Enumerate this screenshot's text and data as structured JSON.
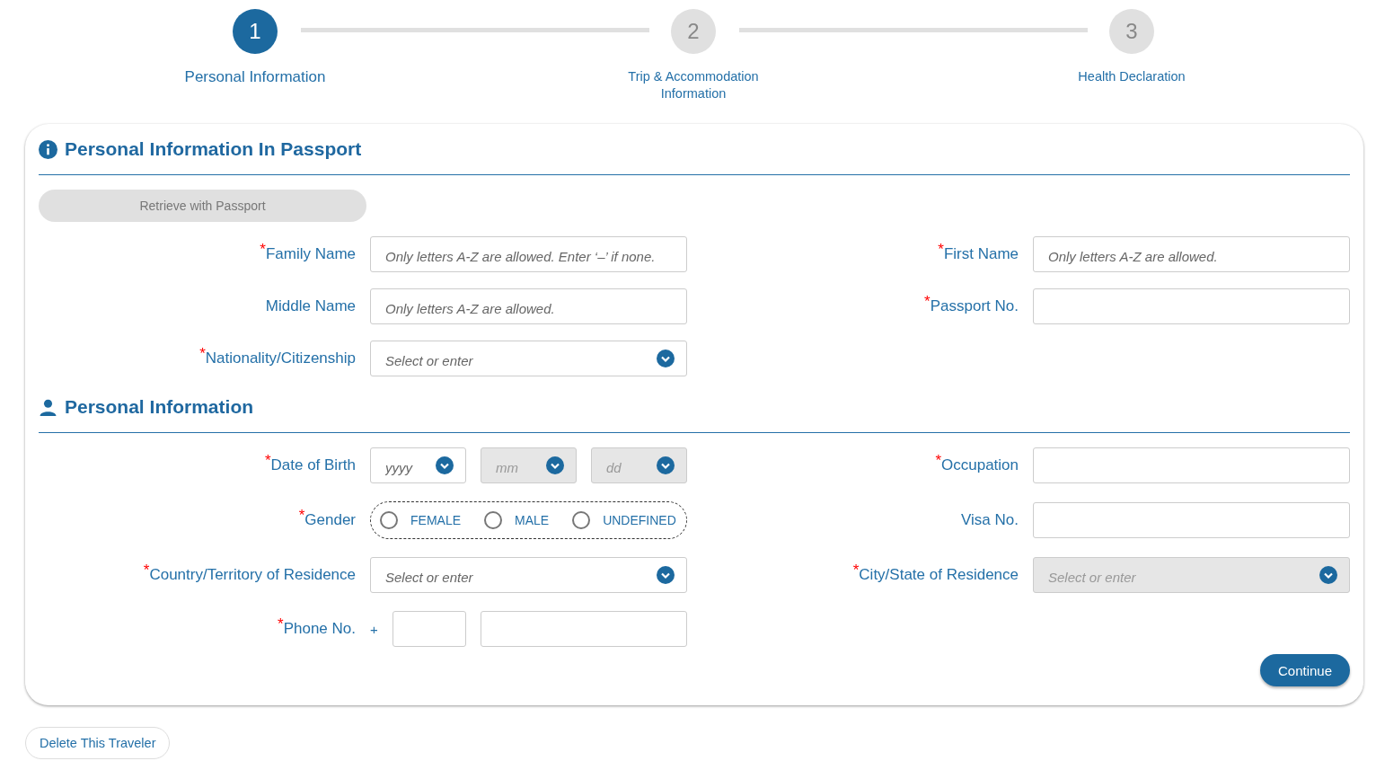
{
  "steps": [
    {
      "number": "1",
      "label": "Personal Information",
      "selected": true
    },
    {
      "number": "2",
      "label": "Trip & Accommodation Information",
      "selected": false
    },
    {
      "number": "3",
      "label": "Health Declaration",
      "selected": false
    }
  ],
  "sections": [
    {
      "kind": "info",
      "title": "Personal Information In Passport",
      "retrieve_button": "Retrieve with Passport",
      "rows": [
        {
          "left": {
            "kind": "text",
            "mark": "*",
            "label": "Family Name",
            "placeholder": "Only letters A-Z are allowed. Enter ‘–’ if none."
          },
          "right": {
            "kind": "text",
            "mark": "*",
            "label": "First Name",
            "placeholder": "Only letters A-Z are allowed."
          }
        },
        {
          "left": {
            "kind": "text",
            "label": "Middle Name",
            "placeholder": "Only letters A-Z are allowed."
          },
          "right": {
            "kind": "text",
            "mark": "*",
            "label": "Passport No."
          }
        },
        {
          "left": {
            "kind": "select",
            "mark": "*",
            "label": "Nationality/Citizenship",
            "placeholder": "Select or enter",
            "disabled": false
          }
        }
      ]
    },
    {
      "kind": "person",
      "title": "Personal Information",
      "rows": [
        {
          "left": {
            "kind": "date",
            "mark": "*",
            "label": "Date of Birth",
            "parts": [
              {
                "placeholder": "yyyy",
                "disabled": false
              },
              {
                "placeholder": "mm",
                "disabled": true
              },
              {
                "placeholder": "dd",
                "disabled": true
              }
            ]
          },
          "right": {
            "kind": "text",
            "mark": "*",
            "label": "Occupation"
          }
        },
        {
          "left": {
            "kind": "radio",
            "mark": "*",
            "label": "Gender",
            "options": [
              {
                "label": "FEMALE",
                "selected": false
              },
              {
                "label": "MALE",
                "selected": false
              },
              {
                "label": "UNDEFINED",
                "selected": false
              }
            ]
          },
          "right": {
            "kind": "text",
            "label": "Visa No."
          }
        },
        {
          "left": {
            "kind": "select",
            "mark": "*",
            "label": "Country/Territory of Residence",
            "placeholder": "Select or enter",
            "disabled": false
          },
          "right": {
            "kind": "select",
            "mark": "*",
            "label": "City/State of Residence",
            "placeholder": "Select or enter",
            "disabled": true
          }
        },
        {
          "left": {
            "kind": "phone",
            "mark": "*",
            "label": "Phone No.",
            "prefix": "+"
          }
        }
      ]
    }
  ],
  "continue_button": "Continue",
  "delete_button": "Delete This Traveler"
}
